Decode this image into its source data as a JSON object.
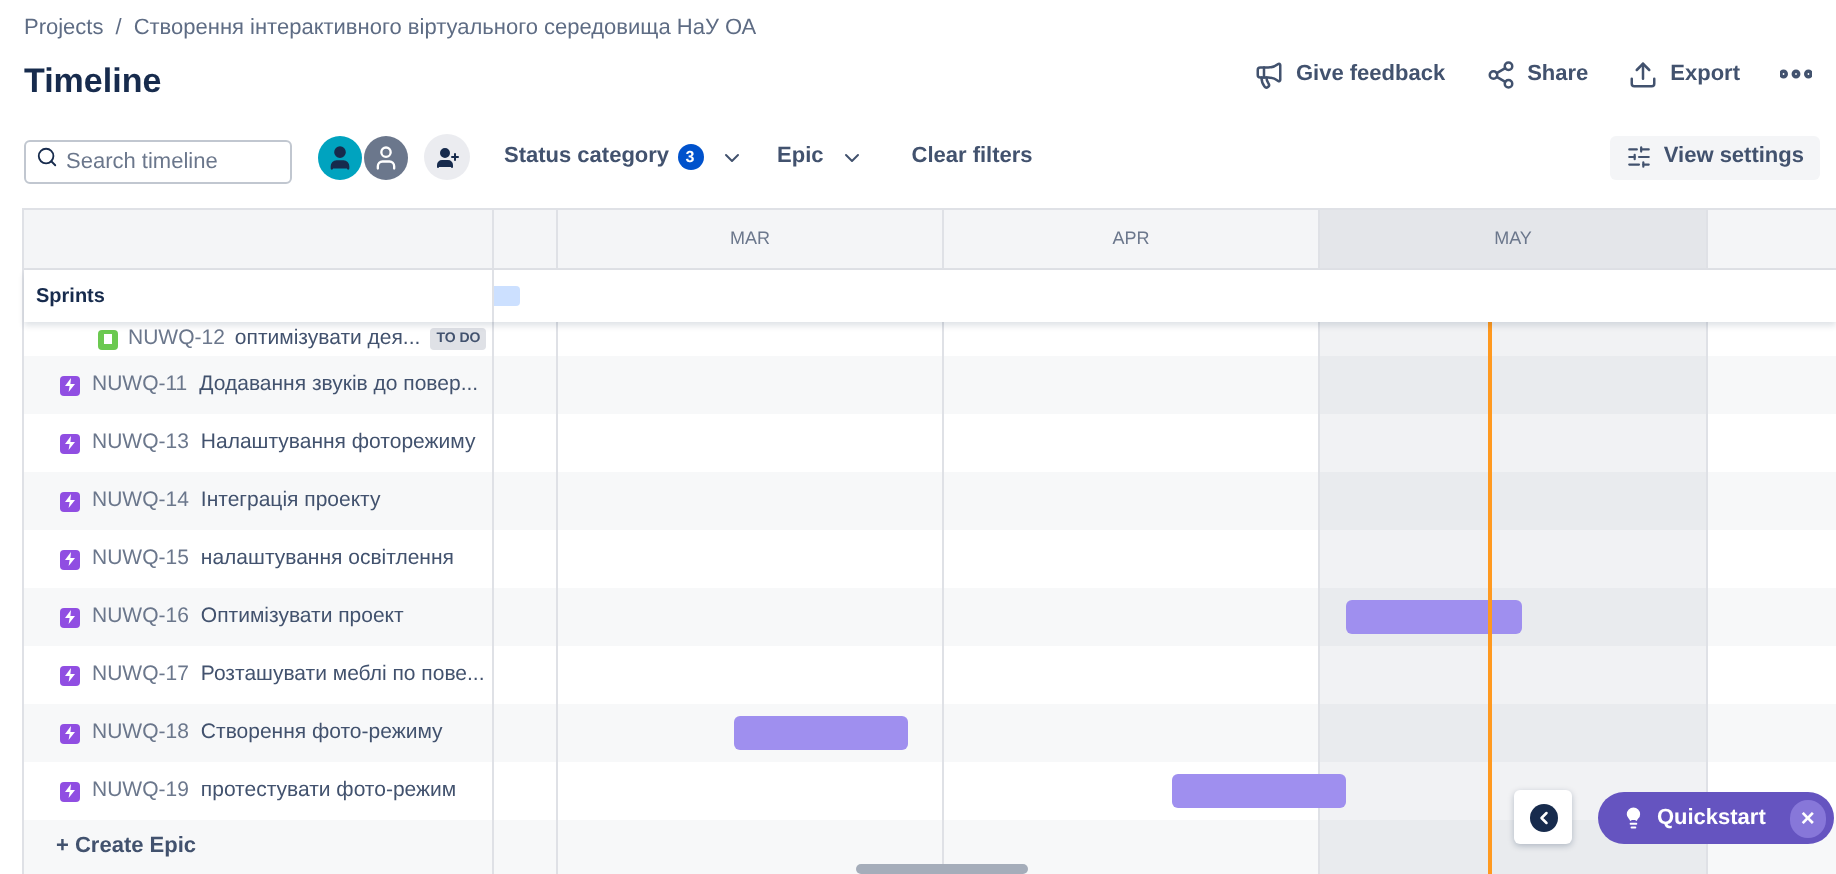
{
  "breadcrumb": {
    "items": [
      "Projects",
      "Створення інтерактивного віртуального середовища НаУ ОА"
    ],
    "separator": "/"
  },
  "title": "Timeline",
  "header_actions": [
    {
      "kind": "feedback",
      "label": "Give feedback"
    },
    {
      "kind": "share",
      "label": "Share"
    },
    {
      "kind": "export",
      "label": "Export"
    },
    {
      "kind": "more"
    }
  ],
  "search": {
    "placeholder": "Search timeline"
  },
  "filters": [
    {
      "label": "Status category",
      "count": "3"
    },
    {
      "label": "Epic"
    }
  ],
  "clear_filters": "Clear filters",
  "view_settings": "View settings",
  "months": [
    {
      "label": "MAR",
      "current": false
    },
    {
      "label": "APR",
      "current": false
    },
    {
      "label": "MAY",
      "current": true
    }
  ],
  "sprints_label": "Sprints",
  "child_issue": {
    "key": "NUWQ-12",
    "summary": "оптимізувати дея...",
    "status": "TO DO"
  },
  "epics": [
    {
      "key": "NUWQ-11",
      "summary": "Додавання звуків до повер...",
      "has_bar": false
    },
    {
      "key": "NUWQ-13",
      "summary": "Налаштування фоторежиму",
      "has_bar": false
    },
    {
      "key": "NUWQ-14",
      "summary": "Інтеграція проекту",
      "has_bar": false
    },
    {
      "key": "NUWQ-15",
      "summary": "налаштування освітлення",
      "has_bar": false
    },
    {
      "key": "NUWQ-16",
      "summary": "Оптимізувати проект",
      "has_bar": true
    },
    {
      "key": "NUWQ-17",
      "summary": "Розташувати меблі по пове...",
      "has_bar": false
    },
    {
      "key": "NUWQ-18",
      "summary": "Створення фото-режиму",
      "has_bar": true
    },
    {
      "key": "NUWQ-19",
      "summary": "протестувати фото-режим",
      "has_bar": true
    }
  ],
  "create_epic": "+ Create Epic",
  "quickstart": {
    "label": "Quickstart",
    "close": "×"
  }
}
